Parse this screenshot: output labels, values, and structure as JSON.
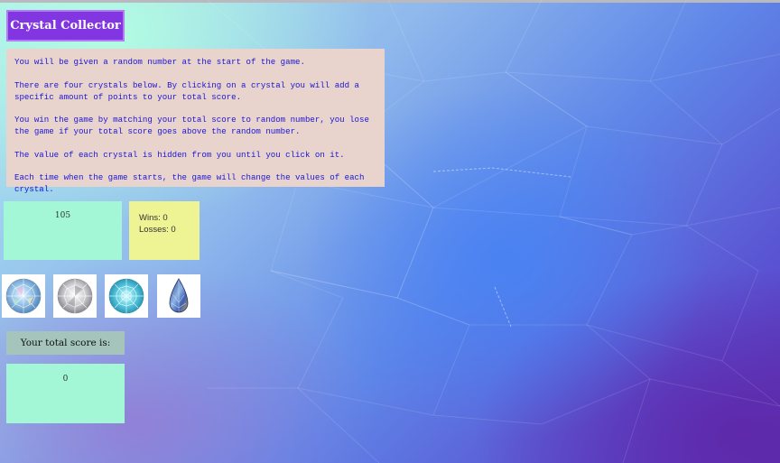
{
  "header": {
    "title": "Crystal Collector"
  },
  "instructions": [
    "You will be given a random number at the start of the game.",
    "There are four crystals below. By clicking on a crystal you will add a specific amount of points to your total score.",
    "You win the game by matching your total score to random number, you lose the game if your total score goes above the random number.",
    "The value of each crystal is hidden from you until you click on it.",
    "Each time when the game starts, the game will change the values of each crystal."
  ],
  "game": {
    "random_number": "105",
    "wins": "Wins: 0",
    "losses": "Losses: 0",
    "score_label": "Your total score is:",
    "total_score": "0"
  },
  "crystals": [
    {
      "icon": "round-blue-rainbow-crystal-icon"
    },
    {
      "icon": "round-clear-crystal-icon"
    },
    {
      "icon": "round-aqua-crystal-icon"
    },
    {
      "icon": "teardrop-crystal-icon"
    }
  ],
  "colors": {
    "title_button": "#8236e2",
    "instructions_bg": "#e8d4cc",
    "instructions_text": "#1a14d6",
    "number_box": "#a3f7d6",
    "stats_box": "#eef394",
    "score_label_bg": "#a4c4bc"
  }
}
